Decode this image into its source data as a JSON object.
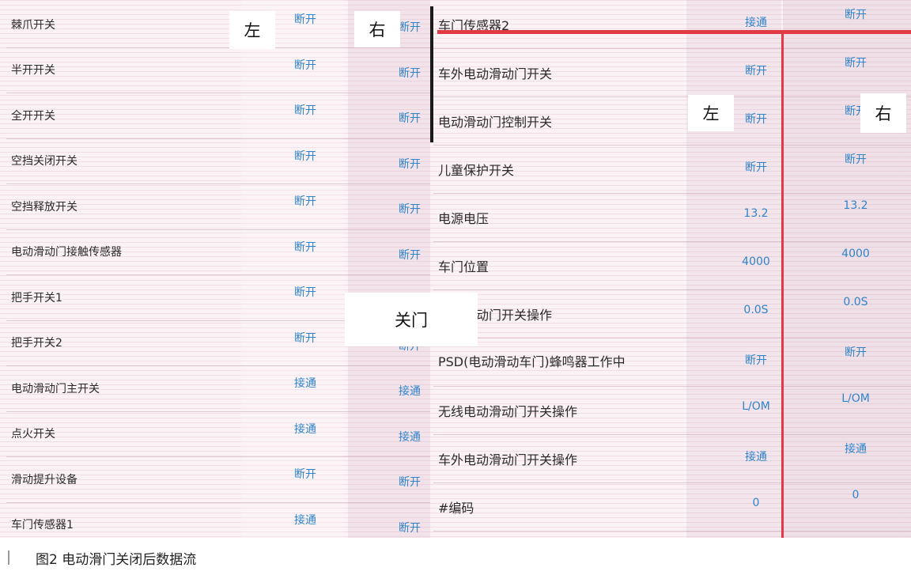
{
  "colors": {
    "value_text": "#2f84cc",
    "label_text": "#2a2a2a",
    "red_line": "#e23a45"
  },
  "left_table": {
    "rows": [
      {
        "label": "棘爪开关",
        "left": "断开",
        "right": "断开"
      },
      {
        "label": "半开开关",
        "left": "断开",
        "right": "断开"
      },
      {
        "label": "全开开关",
        "left": "断开",
        "right": "断开"
      },
      {
        "label": "空挡关闭开关",
        "left": "断开",
        "right": "断开"
      },
      {
        "label": "空挡释放开关",
        "left": "断开",
        "right": "断开"
      },
      {
        "label": "电动滑动门接触传感器",
        "left": "断开",
        "right": "断开"
      },
      {
        "label": "把手开关1",
        "left": "断开",
        "right": "断开"
      },
      {
        "label": "把手开关2",
        "left": "断开",
        "right": "断开"
      },
      {
        "label": "电动滑动门主开关",
        "left": "接通",
        "right": "接通"
      },
      {
        "label": "点火开关",
        "left": "接通",
        "right": "接通"
      },
      {
        "label": "滑动提升设备",
        "left": "断开",
        "right": "断开"
      },
      {
        "label": "车门传感器1",
        "left": "接通",
        "right": "断开"
      }
    ]
  },
  "right_table": {
    "rows": [
      {
        "label": "车门传感器2",
        "left": "接通",
        "right": "断开"
      },
      {
        "label": "车外电动滑动门开关",
        "left": "断开",
        "right": "断开"
      },
      {
        "label": "电动滑动门控制开关",
        "left": "断开",
        "right": "断开"
      },
      {
        "label": "儿童保护开关",
        "left": "断开",
        "right": "断开"
      },
      {
        "label": "电源电压",
        "left": "13.2",
        "right": "13.2"
      },
      {
        "label": "车门位置",
        "left": "4000",
        "right": "4000"
      },
      {
        "label": "电动滑动门开关操作",
        "left": "0.0S",
        "right": "0.0S"
      },
      {
        "label": "PSD(电动滑动车门)蜂鸣器工作中",
        "left": "断开",
        "right": "断开"
      },
      {
        "label": "无线电动滑动门开关操作",
        "left": "L/OM",
        "right": "L/OM"
      },
      {
        "label": "车外电动滑动门开关操作",
        "left": "接通",
        "right": "接通"
      },
      {
        "label": "#编码",
        "left": "0",
        "right": "0"
      }
    ]
  },
  "overlays": {
    "left_zuo": "左",
    "left_you": "右",
    "right_zuo": "左",
    "right_you": "右",
    "guanmen": "关门"
  },
  "caption": "图2   电动滑门关闭后数据流"
}
